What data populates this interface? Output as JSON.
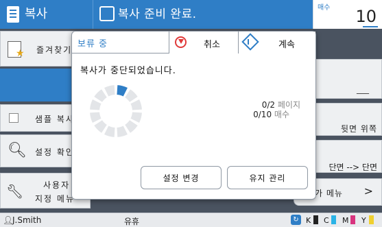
{
  "header": {
    "app_title": "복사",
    "status": "복사 준비 완료.",
    "count_label": "매수",
    "count_value": "10"
  },
  "sidebar": {
    "favorites": "즐겨찾기",
    "sample_copy": "샘플 복사",
    "check_settings": "설정 확인",
    "custom_line1": "사용자",
    "custom_line2": "지정 메뉴"
  },
  "right_panel": {
    "blank_value": "___",
    "back_side": "뒷면 위쪽",
    "duplex": "단면 --> 단면",
    "more_menu": "가 메뉴"
  },
  "dialog": {
    "title": "보류 중",
    "cancel": "취소",
    "continue": "계속",
    "message": "복사가 중단되었습니다.",
    "pages_value": "0/2",
    "pages_unit": "페이지",
    "copies_value": "0/10",
    "copies_unit": "매수",
    "change_settings": "설정 변경",
    "maintenance": "유지 관리"
  },
  "statusbar": {
    "user": "J.Smith",
    "state": "유휴",
    "ink": [
      "K",
      "C",
      "M",
      "Y"
    ]
  },
  "colors": {
    "accent": "#2f7ec6",
    "cancel_red": "#e03a3a",
    "ink_k": "#222222",
    "ink_c": "#2bb3e6",
    "ink_m": "#d9347f",
    "ink_y": "#f0d030"
  }
}
